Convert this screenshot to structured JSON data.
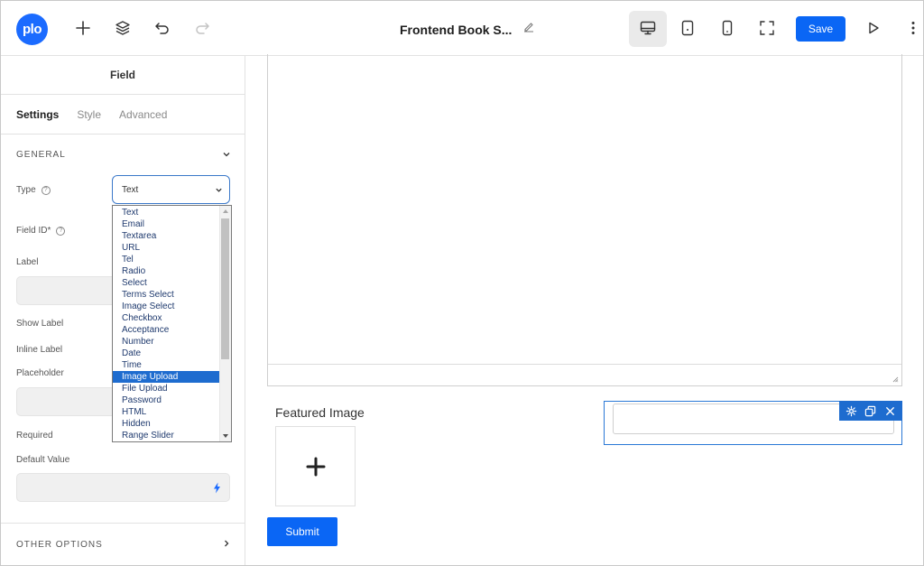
{
  "app": {
    "logo_text": "plo",
    "page_title": "Frontend Book S..."
  },
  "toolbar": {
    "save_label": "Save"
  },
  "sidebar": {
    "header": "Field",
    "tabs": [
      "Settings",
      "Style",
      "Advanced"
    ],
    "general_section": "GENERAL",
    "other_section": "OTHER OPTIONS",
    "labels": {
      "type": "Type",
      "field_id": "Field ID*",
      "label": "Label",
      "show_label": "Show Label",
      "inline_label": "Inline Label",
      "placeholder": "Placeholder",
      "required": "Required",
      "default_value": "Default Value"
    },
    "type_select": {
      "value": "Text",
      "options": [
        "Text",
        "Email",
        "Textarea",
        "URL",
        "Tel",
        "Radio",
        "Select",
        "Terms Select",
        "Image Select",
        "Checkbox",
        "Acceptance",
        "Number",
        "Date",
        "Time",
        "Image Upload",
        "File Upload",
        "Password",
        "HTML",
        "Hidden",
        "Range Slider"
      ],
      "highlighted": "Image Upload"
    }
  },
  "canvas": {
    "featured_image_label": "Featured Image",
    "submit_label": "Submit"
  },
  "colors": {
    "accent": "#0a66f5",
    "selection": "#1e6ccf"
  }
}
